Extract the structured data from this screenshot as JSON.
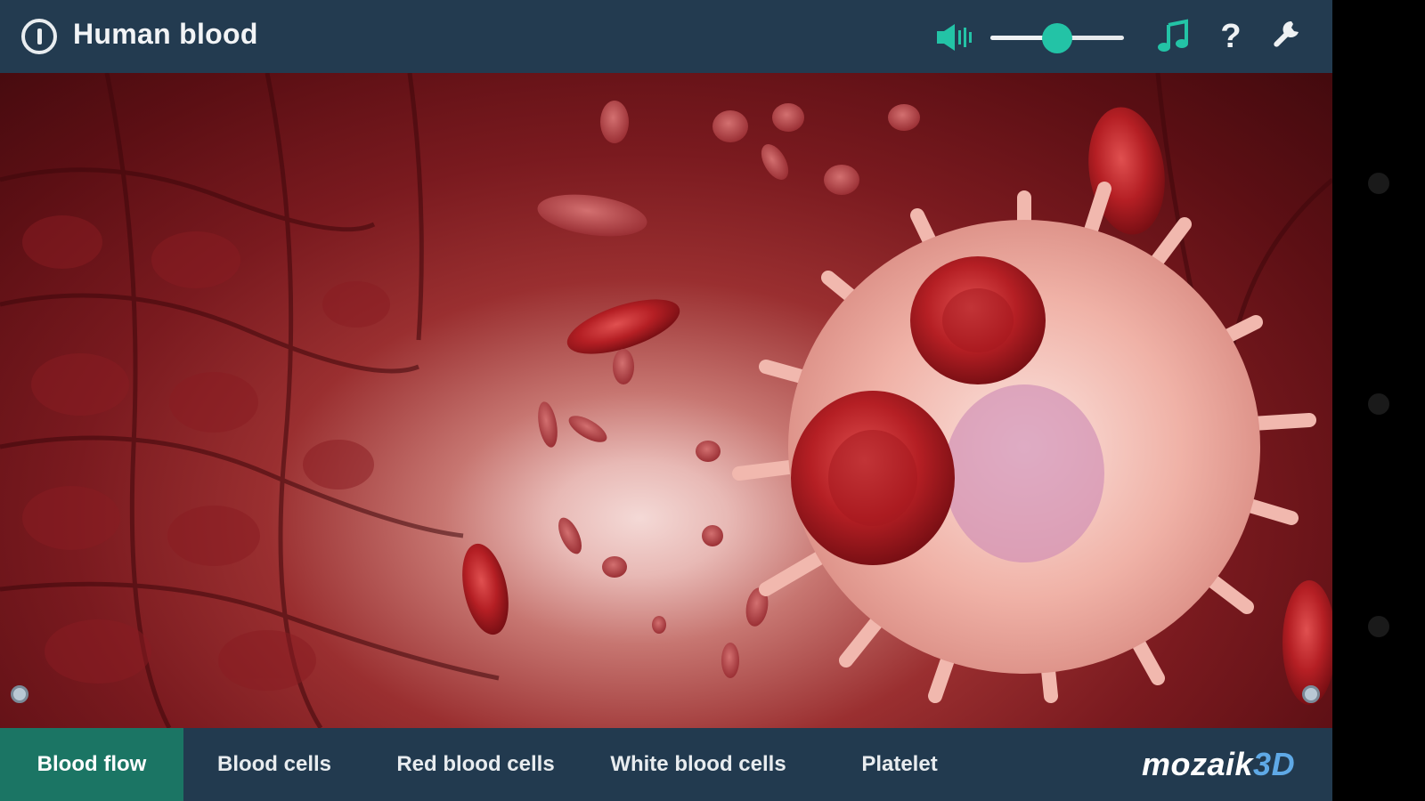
{
  "header": {
    "title": "Human blood",
    "icons": {
      "info": "info-icon",
      "speaker": "speaker-icon",
      "music": "music-note-icon",
      "help": "help-icon",
      "settings": "wrench-icon"
    },
    "help_glyph": "?",
    "volume_level": 0.5
  },
  "tabs": [
    {
      "label": "Blood flow",
      "active": true
    },
    {
      "label": "Blood cells",
      "active": false
    },
    {
      "label": "Red blood cells",
      "active": false
    },
    {
      "label": "White blood cells",
      "active": false
    },
    {
      "label": "Platelet",
      "active": false
    }
  ],
  "brand": {
    "name": "mozaik",
    "accent": "3D"
  },
  "colors": {
    "accent_teal": "#23c3a6",
    "active_tab": "#1b7564",
    "bar_background": "#223a4f",
    "brand_accent": "#5fa9e6"
  }
}
